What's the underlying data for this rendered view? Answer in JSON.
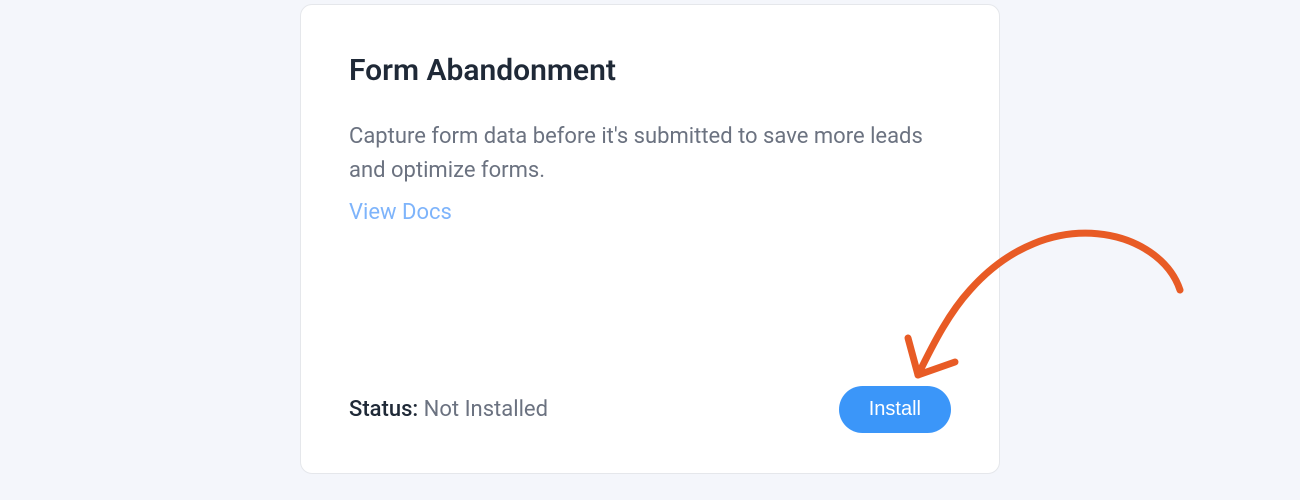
{
  "card": {
    "title": "Form Abandonment",
    "description": "Capture form data before it's submitted to save more leads and optimize forms.",
    "docs_link_label": "View Docs",
    "status_label": "Status:",
    "status_value": "Not Installed",
    "install_button_label": "Install"
  },
  "annotation": {
    "arrow_color": "#e85b25"
  }
}
